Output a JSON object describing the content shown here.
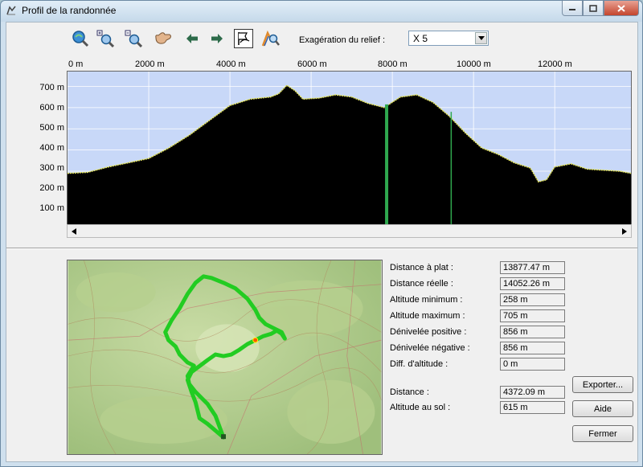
{
  "window": {
    "title": "Profil de la randonnée"
  },
  "toolbar": {
    "tools": [
      {
        "name": "zoom-all-icon",
        "color": "#2f7fc0"
      },
      {
        "name": "zoom-in-icon",
        "color": "#2f7fc0"
      },
      {
        "name": "zoom-out-icon",
        "color": "#2f7fc0"
      },
      {
        "name": "hand-pan-icon",
        "color": "#c79a70"
      },
      {
        "name": "arrow-left-icon",
        "color": "#2c6a4a"
      },
      {
        "name": "arrow-right-icon",
        "color": "#2c6a4a"
      },
      {
        "name": "profile-flag-icon",
        "color": "#000000"
      },
      {
        "name": "route-search-icon",
        "color": "#d9822b"
      }
    ],
    "relief_label": "Exagération du relief :",
    "relief_value": "X 5"
  },
  "chart_data": {
    "type": "area",
    "xlabel": "",
    "ylabel": "",
    "x_ticks": [
      "0 m",
      "2000 m",
      "4000 m",
      "6000 m",
      "8000 m",
      "10000 m",
      "12000 m"
    ],
    "y_ticks": [
      "700 m",
      "600 m",
      "500 m",
      "400 m",
      "300 m",
      "200 m",
      "100 m"
    ],
    "xlim": [
      0,
      13877
    ],
    "ylim": [
      50,
      770
    ],
    "x": [
      0,
      500,
      1000,
      1500,
      2000,
      2500,
      3000,
      3500,
      4000,
      4500,
      5000,
      5200,
      5400,
      5600,
      5800,
      6200,
      6600,
      7000,
      7400,
      7800,
      8200,
      8600,
      9000,
      9400,
      9800,
      10200,
      10600,
      11000,
      11400,
      11600,
      11800,
      12000,
      12400,
      12800,
      13200,
      13600,
      13877
    ],
    "y": [
      290,
      295,
      320,
      340,
      360,
      410,
      470,
      540,
      610,
      640,
      650,
      665,
      705,
      680,
      640,
      645,
      660,
      650,
      620,
      600,
      650,
      660,
      625,
      560,
      480,
      410,
      380,
      340,
      315,
      250,
      260,
      320,
      335,
      310,
      305,
      300,
      290
    ],
    "markers": [
      {
        "x": 7860,
        "label": ""
      },
      {
        "x": 9450,
        "label": ""
      }
    ],
    "fill_color": "#000000",
    "outline_color": "#e8e85c",
    "background_color": "#c8d8f8",
    "grid": true
  },
  "stats": [
    {
      "label": "Distance à plat :",
      "value": "13877.47 m"
    },
    {
      "label": "Distance réelle :",
      "value": "14052.26 m"
    },
    {
      "label": "Altitude minimum :",
      "value": "258 m"
    },
    {
      "label": "Altitude maximum :",
      "value": "705 m"
    },
    {
      "label": "Dénivelée positive :",
      "value": "856 m"
    },
    {
      "label": "Dénivelée négative :",
      "value": "856 m"
    },
    {
      "label": "Diff. d'altitude :",
      "value": "0 m"
    }
  ],
  "cursor_stats": [
    {
      "label": "Distance :",
      "value": "4372.09 m"
    },
    {
      "label": "Altitude au sol :",
      "value": "615 m"
    }
  ],
  "buttons": {
    "export": "Exporter...",
    "help": "Aide",
    "close": "Fermer"
  },
  "map": {
    "route_color": "#22cc22",
    "position_marker_color": "#ff3300"
  }
}
